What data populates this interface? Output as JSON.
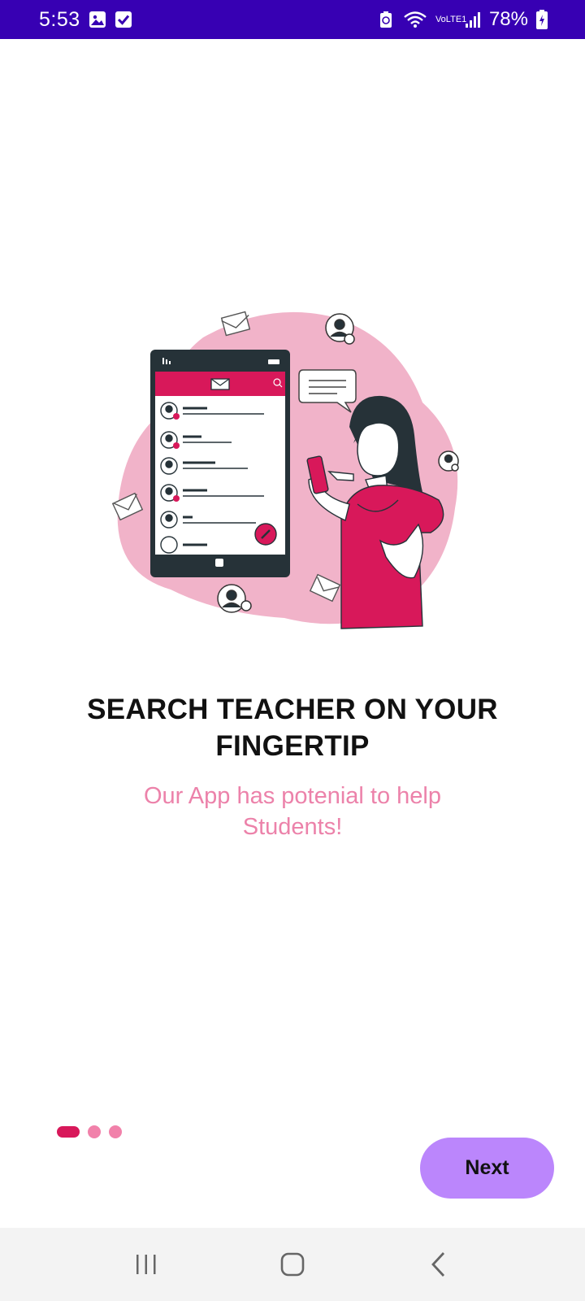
{
  "status_bar": {
    "time": "5:53",
    "battery": "78%",
    "network": "VoLTE1",
    "icons": [
      "gallery-icon",
      "checkbox-icon",
      "battery-saver-icon",
      "wifi-icon",
      "volte-icon",
      "signal-icon",
      "battery-icon"
    ],
    "background_color": "#3700b3"
  },
  "onboarding": {
    "headline": "SEARCH TEACHER ON YOUR FINGERTIP",
    "subtitle": "Our App has potenial to help Students!",
    "page_indicator": {
      "current": 1,
      "total": 3
    },
    "next_label": "Next",
    "accent_color": "#d8185a",
    "button_color": "#bb86fc"
  },
  "nav_bar": {
    "icons": [
      "recent-apps-icon",
      "home-icon",
      "back-icon"
    ]
  }
}
